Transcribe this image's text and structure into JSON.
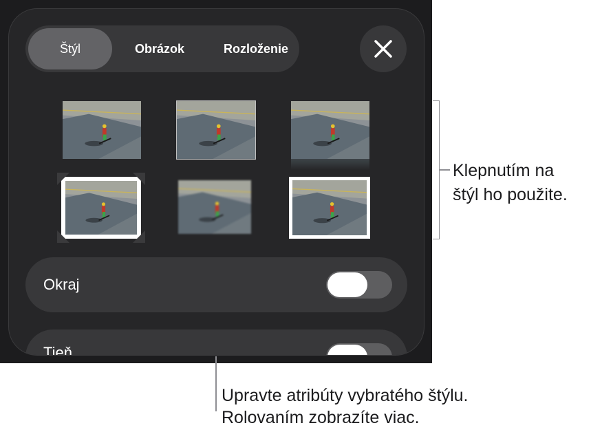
{
  "tabs": {
    "style": "Štýl",
    "image": "Obrázok",
    "layout": "Rozloženie"
  },
  "close_icon": "close-icon",
  "style_presets": [
    {
      "name": "style-1",
      "variant": "plain"
    },
    {
      "name": "style-2",
      "variant": "thin-border"
    },
    {
      "name": "style-3",
      "variant": "reflection"
    },
    {
      "name": "style-4",
      "variant": "photo-corners"
    },
    {
      "name": "style-5",
      "variant": "soft-edge"
    },
    {
      "name": "style-6",
      "variant": "white-frame"
    }
  ],
  "options": {
    "border_label": "Okraj",
    "shadow_label": "Tieň",
    "border_on": false,
    "shadow_on": false
  },
  "callouts": {
    "styles_line1": "Klepnutím na",
    "styles_line2": "štýl ho použite.",
    "attrs_line1": "Upravte atribúty vybratého štýlu.",
    "attrs_line2": "Rolovaním zobrazíte viac."
  },
  "colors": {
    "panel": "#262628",
    "segment": "#38383a",
    "segment_active": "#636366",
    "callout_line": "#8e8e93"
  }
}
